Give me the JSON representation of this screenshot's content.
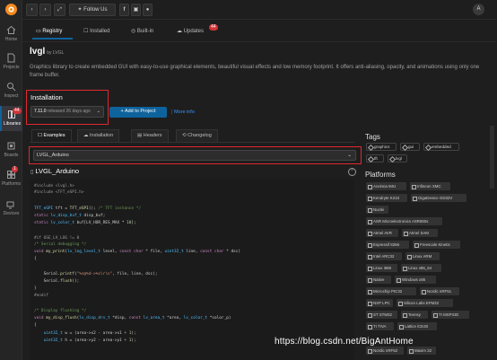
{
  "leftbar": {
    "items": [
      {
        "label": "Home",
        "icon": "home-icon"
      },
      {
        "label": "Projects",
        "icon": "projects-icon"
      },
      {
        "label": "Inspect",
        "icon": "inspect-icon"
      },
      {
        "label": "Libraries",
        "icon": "libraries-icon",
        "badge": "44"
      },
      {
        "label": "Boards",
        "icon": "boards-icon"
      },
      {
        "label": "Platforms",
        "icon": "platforms-icon",
        "badge": "1"
      },
      {
        "label": "Devices",
        "icon": "devices-icon"
      }
    ]
  },
  "topbar": {
    "follow_label": "Follow Us",
    "user_initial": "A"
  },
  "tabs": {
    "registry": "Registry",
    "installed": "Installed",
    "builtin": "Built-in",
    "updates": "Updates",
    "updates_badge": "44"
  },
  "library": {
    "name": "lvgl",
    "by": "by LVGL",
    "description": "Graphics library to create embedded GUI with easy-to-use graphical elements, beautiful visual effects and low memory footprint. It offers anti-aliasing, opacity, and animations using only one frame buffer."
  },
  "installation": {
    "heading": "Installation",
    "version": "7.11.0",
    "released": "released 26 days ago",
    "add_button": "Add to Project",
    "more_info": "More info"
  },
  "subtabs": {
    "examples": "Examples",
    "installation": "Installation",
    "headers": "Headers",
    "changelog": "Changelog"
  },
  "example": {
    "selected": "LVGL_Arduino",
    "file_title": "LVGL_Arduino"
  },
  "code": {
    "lines": [
      "#include <lvgl.h>",
      "#include <TFT_eSPI.h>",
      "",
      "TFT_eSPI tft = TFT_eSPI(); /* TFT instance */",
      "static lv_disp_buf_t disp_buf;",
      "static lv_color_t buf[LV_HOR_RES_MAX * 10];",
      "",
      "#if USE_LV_LOG != 0",
      "/* Serial debugging */",
      "void my_print(lv_log_level_t level, const char * file, uint32_t line, const char * dsc)",
      "{",
      "",
      "    Serial.printf(\"%s@%d->%s\\r\\n\", file, line, dsc);",
      "    Serial.flush();",
      "}",
      "#endif",
      "",
      "/* Display flushing */",
      "void my_disp_flush(lv_disp_drv_t *disp, const lv_area_t *area, lv_color_t *color_p)",
      "{",
      "    uint32_t w = (area->x2 - area->x1 + 1);",
      "    uint32_t h = (area->y2 - area->y1 + 1);"
    ]
  },
  "sidebar": {
    "tags_heading": "Tags",
    "tags": [
      "graphics",
      "gui",
      "embedded",
      "tft",
      "lvgl"
    ],
    "platforms_heading": "Platforms",
    "platforms": [
      "Aceinna IMU",
      "Infineon XMC",
      "Kendryte K210",
      "GigaDevice GD32V",
      "Nuclei",
      "ASR Microelectronics ASR650x",
      "Atmel AVR",
      "Atmel SAM",
      "Espressif 8266",
      "Freescale Kinetis",
      "Intel ARC32",
      "Linux ARM",
      "Linux i686",
      "Linux x86_64",
      "Native",
      "Windows x86",
      "Microchip PIC32",
      "Nordic nRF51",
      "NXP LPC",
      "Silicon Labs EFM32",
      "ST STM32",
      "Teensy",
      "TI MSP430",
      "TI TIVA",
      "Lattice iCE40",
      "Nordic nRF52",
      "Maxim 32"
    ]
  },
  "watermark": "https://blog.csdn.net/BigAntHome",
  "colors": {
    "accent": "#0e639c",
    "highlight": "#e0282e",
    "badge": "#d13438"
  }
}
